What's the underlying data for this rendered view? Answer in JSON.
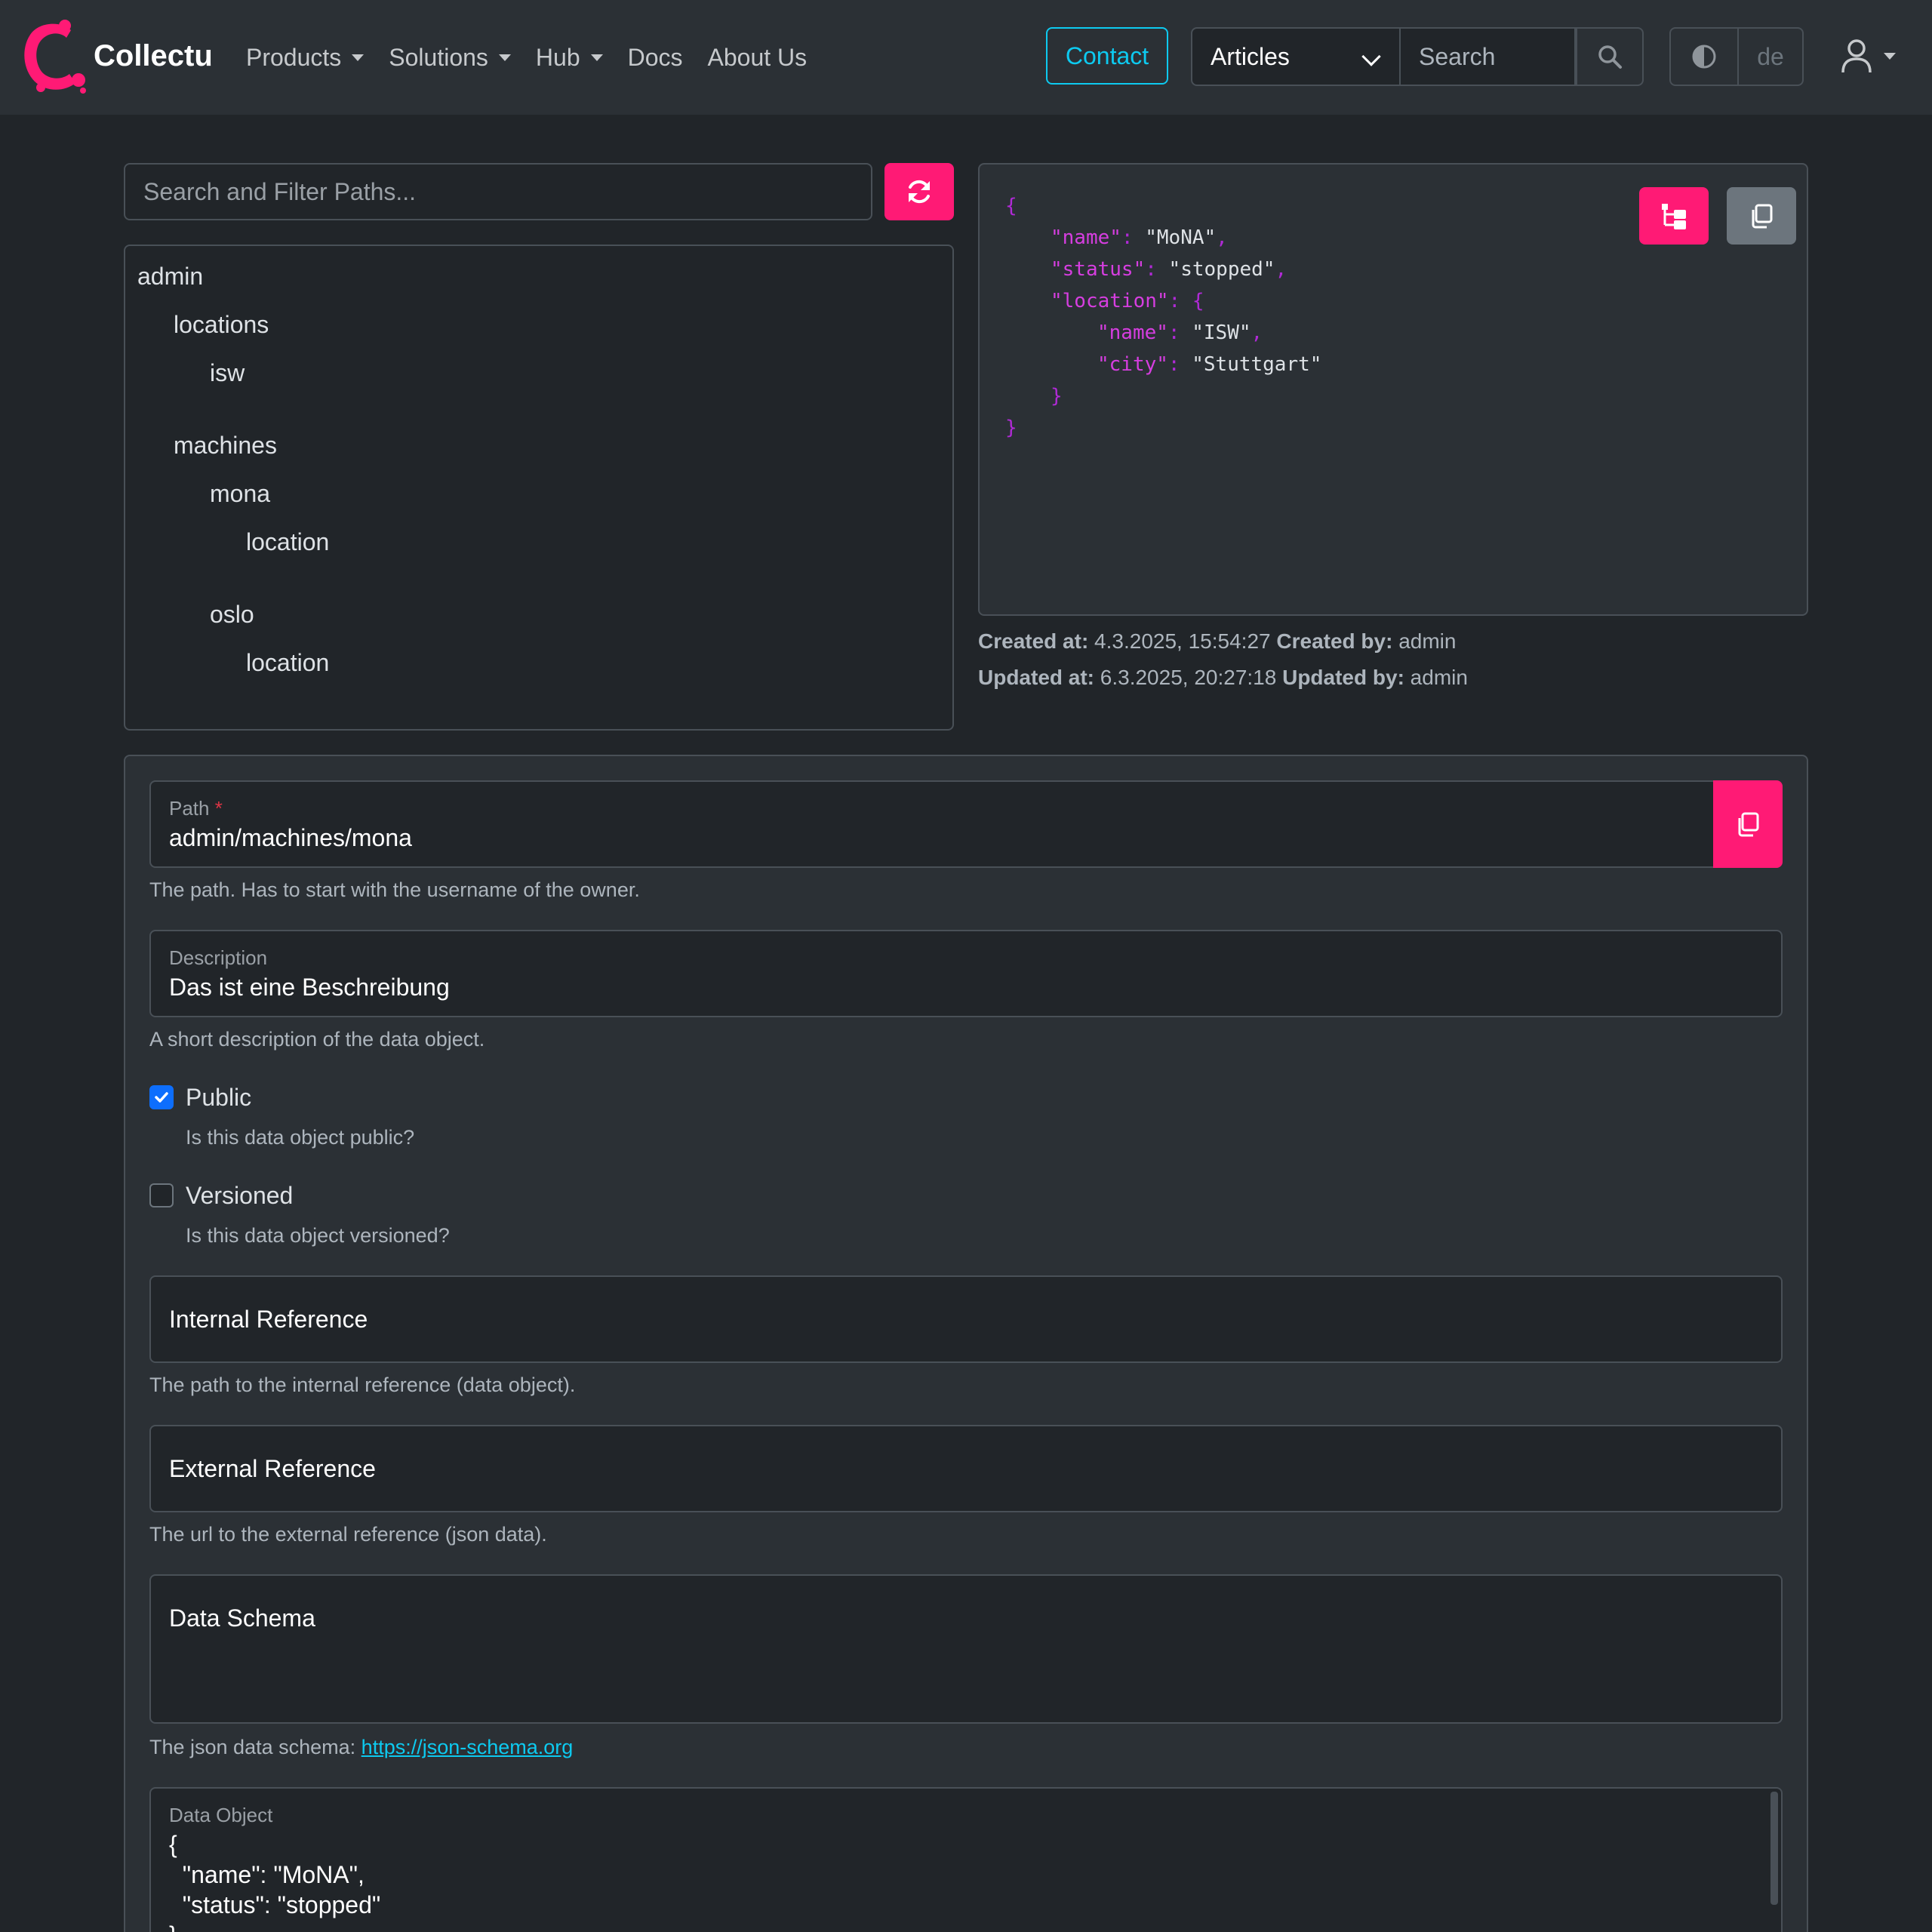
{
  "navbar": {
    "brand": "Collectu",
    "links": [
      {
        "label": "Products",
        "dropdown": true
      },
      {
        "label": "Solutions",
        "dropdown": true
      },
      {
        "label": "Hub",
        "dropdown": true
      },
      {
        "label": "Docs",
        "dropdown": false
      },
      {
        "label": "About Us",
        "dropdown": false
      }
    ],
    "contact_label": "Contact",
    "search_scope": "Articles",
    "search_placeholder": "Search",
    "language": "de"
  },
  "path_filter": {
    "placeholder": "Search and Filter Paths..."
  },
  "tree": [
    {
      "label": "admin",
      "level": 0
    },
    {
      "label": "locations",
      "level": 1
    },
    {
      "label": "isw",
      "level": 2
    },
    {
      "label": "machines",
      "level": 1
    },
    {
      "label": "mona",
      "level": 2
    },
    {
      "label": "location",
      "level": 3
    },
    {
      "label": "oslo",
      "level": 2
    },
    {
      "label": "location",
      "level": 3
    }
  ],
  "json_preview": {
    "open_brace": "{",
    "close_brace": "}",
    "name_key": "\"name\"",
    "name_value": "\"MoNA\"",
    "status_key": "\"status\"",
    "status_value": "\"stopped\"",
    "location_key": "\"location\"",
    "loc_name_key": "\"name\"",
    "loc_name_value": "\"ISW\"",
    "loc_city_key": "\"city\"",
    "loc_city_value": "\"Stuttgart\""
  },
  "meta": {
    "created_at_label": "Created at:",
    "created_at": "4.3.2025, 15:54:27",
    "created_by_label": "Created by:",
    "created_by": "admin",
    "updated_at_label": "Updated at:",
    "updated_at": "6.3.2025, 20:27:18",
    "updated_by_label": "Updated by:",
    "updated_by": "admin"
  },
  "form": {
    "path_label": "Path",
    "path_required": "*",
    "path_value": "admin/machines/mona",
    "path_help": "The path. Has to start with the username of the owner.",
    "description_label": "Description",
    "description_value": "Das ist eine Beschreibung",
    "description_help": "A short description of the data object.",
    "public_label": "Public",
    "public_checked": true,
    "public_help": "Is this data object public?",
    "versioned_label": "Versioned",
    "versioned_checked": false,
    "versioned_help": "Is this data object versioned?",
    "internal_ref_placeholder": "Internal Reference",
    "internal_ref_help": "The path to the internal reference (data object).",
    "external_ref_placeholder": "External Reference",
    "external_ref_help": "The url to the external reference (json data).",
    "schema_placeholder": "Data Schema",
    "schema_help": "The json data schema:",
    "schema_link": "https://json-schema.org",
    "data_object_label": "Data Object",
    "data_object_lines": [
      "{",
      "  \"name\": \"MoNA\",",
      "  \"status\": \"stopped\"",
      "}"
    ]
  },
  "colors": {
    "accent": "#ff1a75",
    "info": "#0dcaf0",
    "primary": "#0d6efd"
  }
}
